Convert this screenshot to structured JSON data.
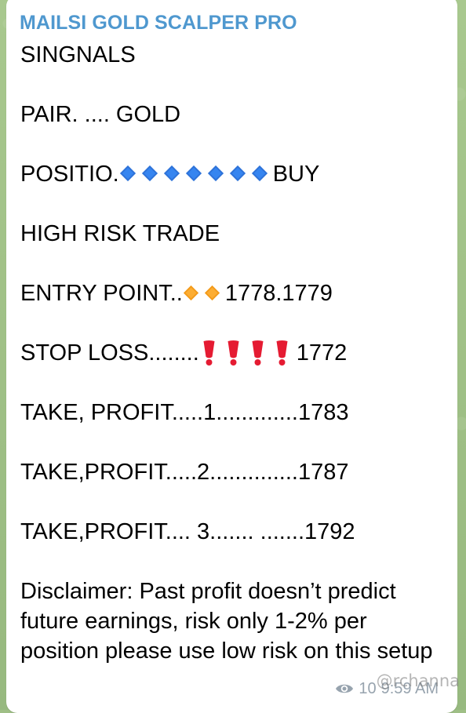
{
  "message": {
    "channel_name": "MAILSI GOLD SCALPER PRO",
    "lines": [
      "SINGNALS",
      "PAIR. .... GOLD",
      "POSITIO.",
      "BUY",
      "HIGH RISK TRADE",
      "ENTRY POINT..",
      "1778.1779",
      "STOP LOSS........",
      "1772",
      "TAKE, PROFIT.....1.............1783",
      "TAKE,PROFIT.....2..............1787",
      "TAKE,PROFIT.... 3....... .......1792"
    ],
    "disclaimer": "Disclaimer: Past profit doesn’t predict future earnings, risk only 1-2% per position please use low risk on this setup",
    "views": "10",
    "time": "9:59 AM",
    "watermark": "@rchanna"
  },
  "icons": {
    "blue_diamond": "small-blue-diamond-icon",
    "orange_diamond": "small-orange-diamond-icon",
    "red_exclamation": "red-heavy-exclamation-icon",
    "views": "eye-icon"
  },
  "colors": {
    "channel_name": "#4f98cf",
    "message_text": "#000000",
    "meta_text": "#97a3ae",
    "background": "#9fbf86",
    "bubble": "#ffffff",
    "blue_diamond": "#2d72d9",
    "orange_diamond": "#f39a19",
    "red_exclamation": "#e51b32"
  }
}
